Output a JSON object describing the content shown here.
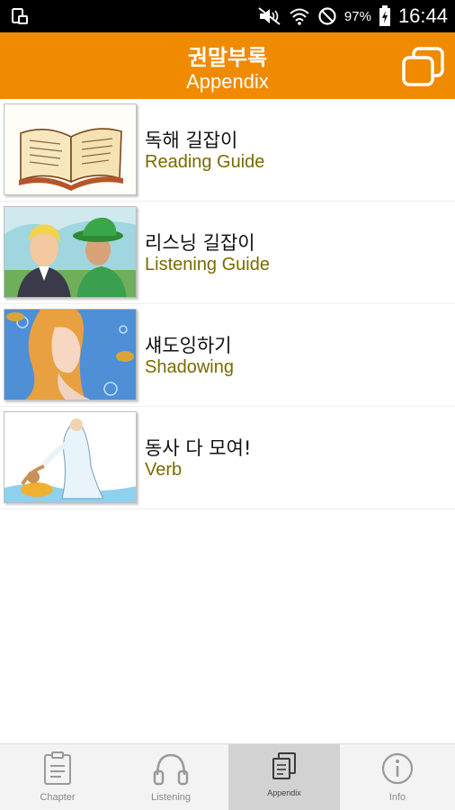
{
  "status_bar": {
    "battery_percent": "97%",
    "time": "16:44"
  },
  "header": {
    "title": "권말부록",
    "subtitle": "Appendix",
    "menu_icon": "windows-icon"
  },
  "list": [
    {
      "title_ko": "독해 길잡이",
      "title_en": "Reading Guide",
      "thumb": "open-book-illustration"
    },
    {
      "title_ko": "리스닝 길잡이",
      "title_en": "Listening Guide",
      "thumb": "two-men-illustration"
    },
    {
      "title_ko": "섀도잉하기",
      "title_en": "Shadowing",
      "thumb": "mermaid-illustration"
    },
    {
      "title_ko": "동사 다 모여!",
      "title_en": "Verb",
      "thumb": "rescue-illustration"
    }
  ],
  "bottom_nav": {
    "active": "Appendix",
    "items": [
      {
        "label": "Chapter",
        "icon": "clipboard-icon"
      },
      {
        "label": "Listening",
        "icon": "headphones-icon"
      },
      {
        "label": "Appendix",
        "icon": "documents-icon"
      },
      {
        "label": "Info",
        "icon": "info-icon"
      }
    ]
  },
  "colors": {
    "header_bg": "#F08A00",
    "subtitle_text": "#7A6A00",
    "nav_active_bg": "#D2D2D2"
  }
}
